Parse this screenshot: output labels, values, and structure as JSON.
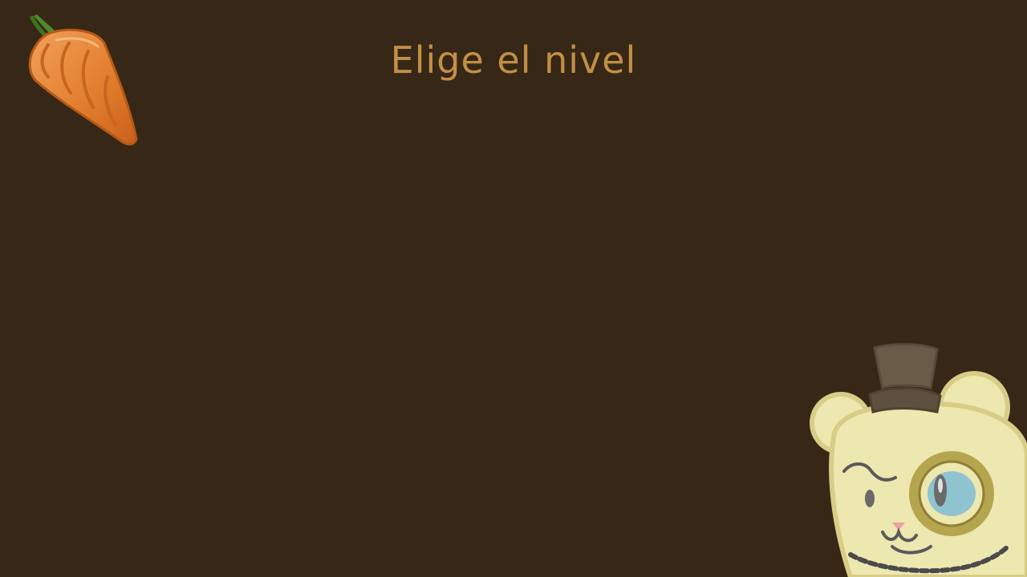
{
  "screen": {
    "title": "Elige el nivel",
    "background_color": "#372716",
    "title_color": "#c38f45"
  },
  "decorations": {
    "top_left": "carrot-icon",
    "bottom_right": "bear-with-top-hat-and-monocle"
  }
}
